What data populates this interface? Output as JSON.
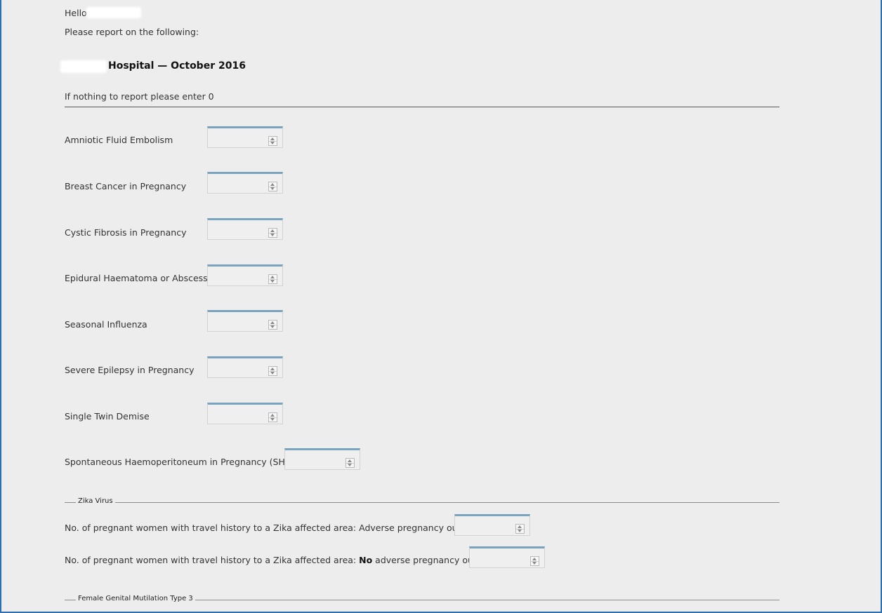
{
  "greeting": {
    "hello": "Hello",
    "prompt": "Please report on the following:"
  },
  "header": {
    "title": "Hospital — October 2016",
    "instruction": "If nothing to report please enter 0"
  },
  "fields": [
    {
      "label": "Amniotic Fluid Embolism",
      "value": ""
    },
    {
      "label": "Breast Cancer in Pregnancy",
      "value": ""
    },
    {
      "label": "Cystic Fibrosis in Pregnancy",
      "value": ""
    },
    {
      "label": "Epidural Haematoma or Abscess",
      "value": ""
    },
    {
      "label": "Seasonal Influenza",
      "value": ""
    },
    {
      "label": "Severe Epilepsy in Pregnancy",
      "value": ""
    },
    {
      "label": "Single Twin Demise",
      "value": ""
    },
    {
      "label": "Spontaneous Haemoperitoneum in Pregnancy (SHiP)",
      "value": ""
    }
  ],
  "zika": {
    "legend": "Zika Virus",
    "adverse_label": "No. of pregnant women with travel history to a Zika affected area: Adverse pregnancy outcome",
    "no_adverse_prefix": "No. of pregnant women with travel history to a Zika affected area: ",
    "no_adverse_bold": "No",
    "no_adverse_suffix": " adverse pregnancy outcome"
  },
  "fgm": {
    "legend": "Female Genital Mutilation Type 3"
  },
  "colors": {
    "frame": "#2f6fb0",
    "stepper_accent": "#7aa4bd",
    "background": "#ededed"
  }
}
